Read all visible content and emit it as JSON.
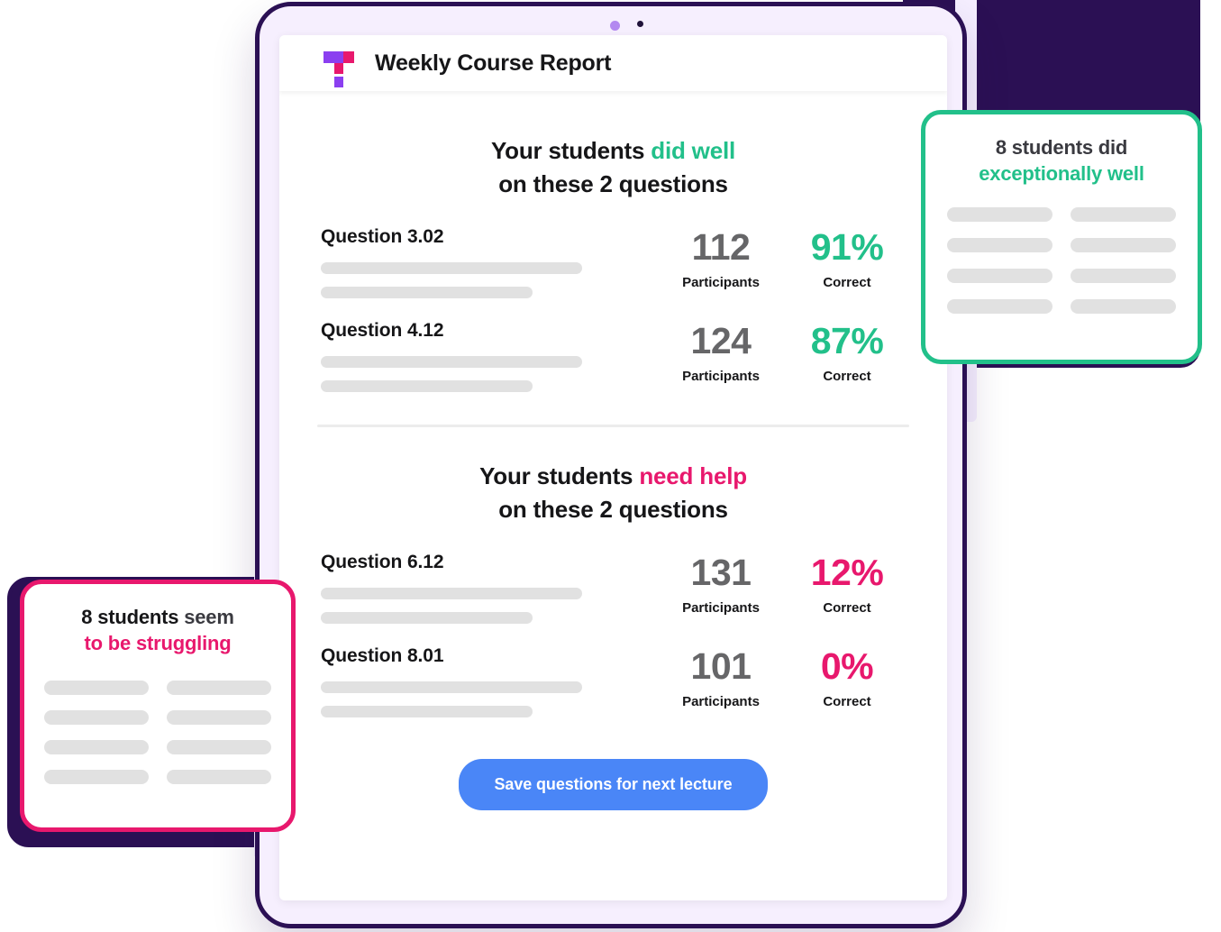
{
  "app": {
    "title": "Weekly Course Report",
    "logo_icon": "tophat-t-logo-icon",
    "logo_colors": {
      "purple": "#8b3ff0",
      "pink": "#e8186d"
    }
  },
  "device": {
    "frame_color": "#2b1054",
    "bezel_color": "#f6effe",
    "camera_dot_icon": "camera-dot-icon",
    "indicator_dot_icon": "indicator-dot-icon"
  },
  "sections": [
    {
      "id": "did-well",
      "heading_prefix": "Your students ",
      "heading_highlight": "did well",
      "heading_line2": "on these 2 questions",
      "highlight_color": "#22c08a",
      "questions": [
        {
          "label": "Question 3.02",
          "participants": "112",
          "participants_caption": "Participants",
          "correct": "91%",
          "correct_caption": "Correct"
        },
        {
          "label": "Question 4.12",
          "participants": "124",
          "participants_caption": "Participants",
          "correct": "87%",
          "correct_caption": "Correct"
        }
      ]
    },
    {
      "id": "need-help",
      "heading_prefix": "Your students ",
      "heading_highlight": "need help",
      "heading_line2": "on these 2 questions",
      "highlight_color": "#e8186d",
      "questions": [
        {
          "label": "Question 6.12",
          "participants": "131",
          "participants_caption": "Participants",
          "correct": "12%",
          "correct_caption": "Correct"
        },
        {
          "label": "Question 8.01",
          "participants": "101",
          "participants_caption": "Participants",
          "correct": "0%",
          "correct_caption": "Correct"
        }
      ]
    }
  ],
  "footer": {
    "save_label": "Save questions for next lecture",
    "save_color": "#4a86f7"
  },
  "floating_cards": {
    "exceptional": {
      "title_line1": "8 students did",
      "title_line2": "exceptionally well",
      "accent_color": "#22c08a",
      "placeholder_rows": 4,
      "placeholder_cols": 2
    },
    "struggling": {
      "title_line1_bold": "8 students",
      "title_line1_rest": " seem",
      "title_line2": "to be struggling",
      "accent_color": "#e8186d",
      "placeholder_rows": 4,
      "placeholder_cols": 2
    }
  }
}
